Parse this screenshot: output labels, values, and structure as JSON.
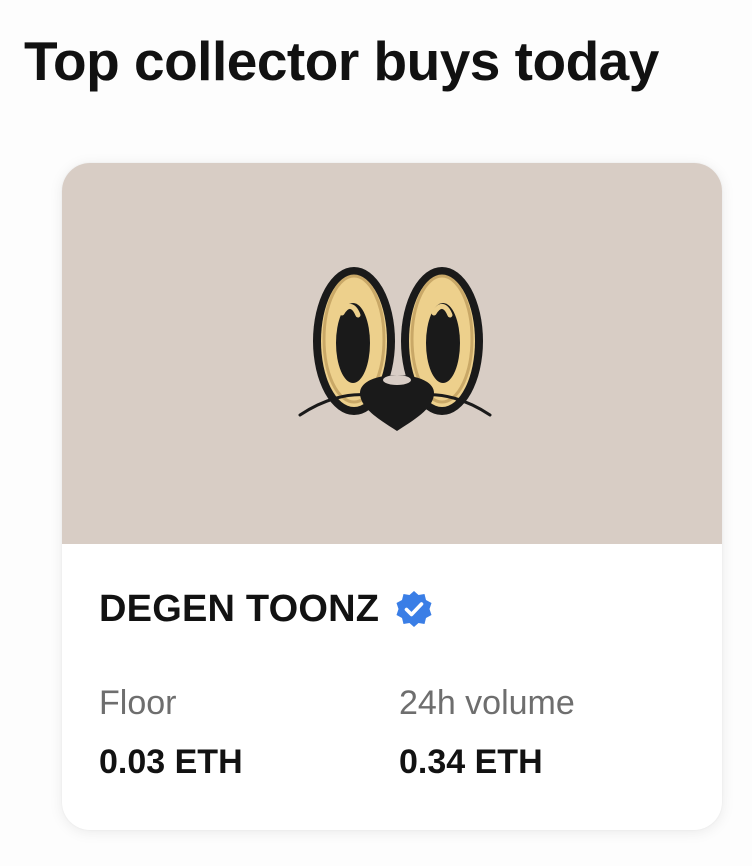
{
  "page": {
    "title": "Top collector buys today"
  },
  "card": {
    "image_icon": "cartoon-eyes-icon",
    "collection_name": "DEGEN TOONZ",
    "verified_icon": "verified-badge-icon",
    "stats": {
      "floor_label": "Floor",
      "floor_value": "0.03 ETH",
      "volume_label": "24h volume",
      "volume_value": "0.34 ETH"
    }
  },
  "colors": {
    "image_background": "#d8cdc5",
    "verified_badge": "#3a7ee6",
    "eye_fill": "#edd08c",
    "outline": "#1a1a1a"
  }
}
